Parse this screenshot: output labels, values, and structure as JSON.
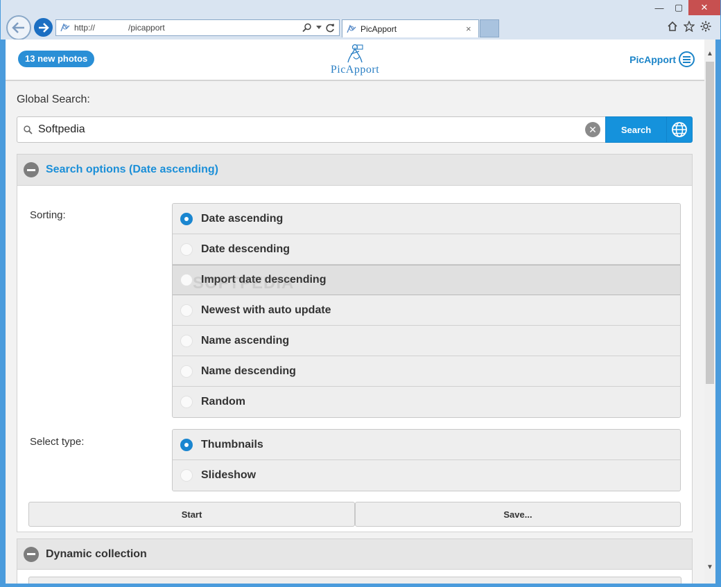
{
  "browser": {
    "address_prefix": "http://",
    "address_path": "/picapport",
    "tab_title": "PicApport",
    "tab_close": "×",
    "window_buttons": {
      "minimize": "—",
      "maximize": "▢",
      "close": "✕"
    }
  },
  "app": {
    "new_photos_label": "13 new photos",
    "logo_text": "PicApport",
    "menu_label": "PicApport"
  },
  "search": {
    "label": "Global Search:",
    "value": "Softpedia",
    "button_label": "Search"
  },
  "options_panel": {
    "title": "Search options (Date ascending)",
    "sorting_label": "Sorting:",
    "sorting_options": [
      {
        "label": "Date ascending",
        "selected": true
      },
      {
        "label": "Date descending",
        "selected": false
      },
      {
        "label": "Import date descending",
        "selected": false
      },
      {
        "label": "Newest with auto update",
        "selected": false
      },
      {
        "label": "Name ascending",
        "selected": false
      },
      {
        "label": "Name descending",
        "selected": false
      },
      {
        "label": "Random",
        "selected": false
      }
    ],
    "type_label": "Select type:",
    "type_options": [
      {
        "label": "Thumbnails",
        "selected": true
      },
      {
        "label": "Slideshow",
        "selected": false
      }
    ],
    "start_label": "Start",
    "save_label": "Save..."
  },
  "dynamic_panel": {
    "title": "Dynamic collection"
  },
  "watermark": "SOFTPEDIA",
  "colors": {
    "accent": "#1592dc",
    "title_blue": "#1b8fd8",
    "badge": "#2a8fd6"
  }
}
